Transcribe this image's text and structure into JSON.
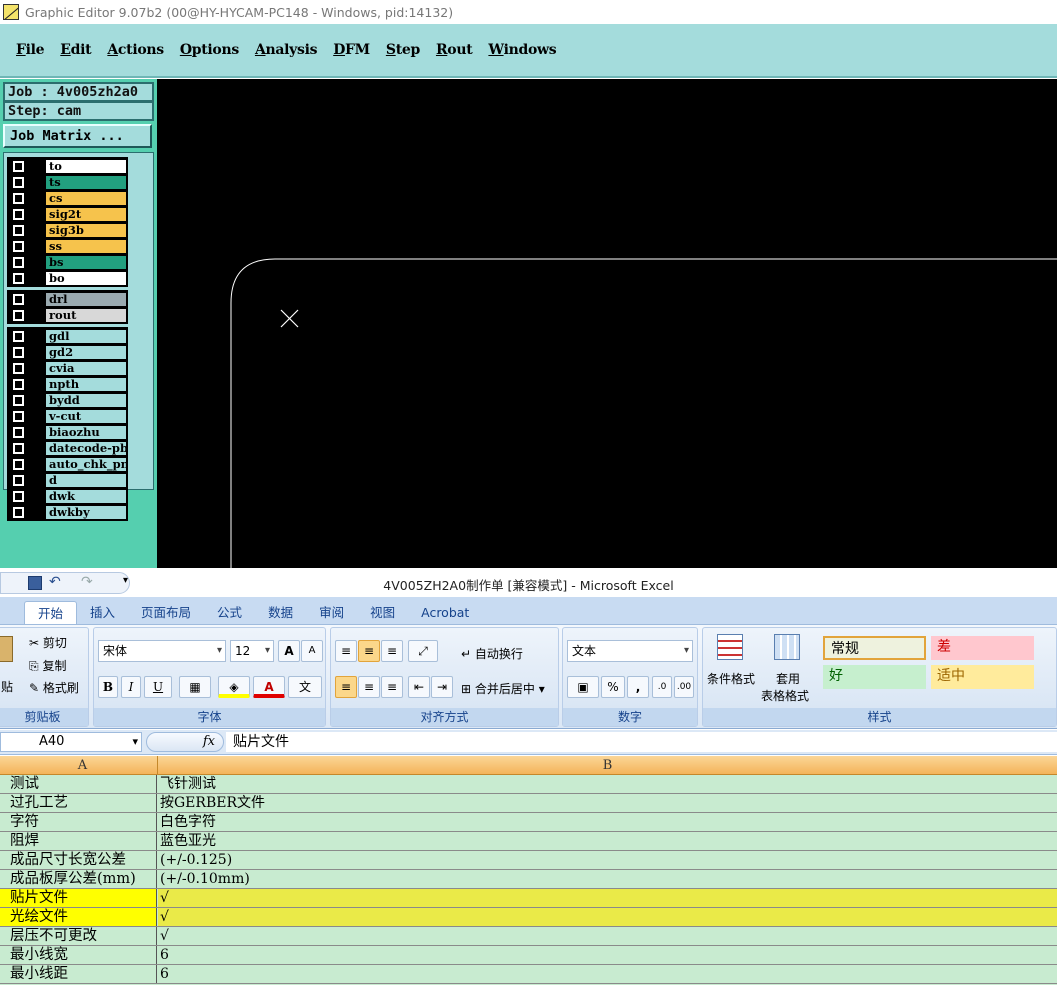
{
  "editor": {
    "title": "Graphic Editor 9.07b2 (00@HY-HYCAM-PC148 - Windows, pid:14132)",
    "menu": [
      "File",
      "Edit",
      "Actions",
      "Options",
      "Analysis",
      "DFM",
      "Step",
      "Rout",
      "Windows"
    ],
    "job_label": "Job : 4v005zh2a0",
    "step_label": "Step: cam",
    "job_matrix": "Job Matrix ...",
    "layer_groups": [
      [
        {
          "name": "to",
          "color": "#ffffff"
        },
        {
          "name": "ts",
          "color": "#22a07f"
        },
        {
          "name": "cs",
          "color": "#f6c34c"
        },
        {
          "name": "sig2t",
          "color": "#f6c34c"
        },
        {
          "name": "sig3b",
          "color": "#f6c34c"
        },
        {
          "name": "ss",
          "color": "#f6c34c"
        },
        {
          "name": "bs",
          "color": "#22a07f"
        },
        {
          "name": "bo",
          "color": "#ffffff"
        }
      ],
      [
        {
          "name": "drl",
          "color": "#9aaab0"
        },
        {
          "name": "rout",
          "color": "#d8d8d8"
        }
      ],
      [
        {
          "name": "gdl",
          "color": "#a4dcdc"
        },
        {
          "name": "gd2",
          "color": "#a4dcdc"
        },
        {
          "name": "cvia",
          "color": "#a4dcdc"
        },
        {
          "name": "npth",
          "color": "#a4dcdc"
        },
        {
          "name": "bydd",
          "color": "#a4dcdc"
        },
        {
          "name": "v-cut",
          "color": "#a4dcdc"
        },
        {
          "name": "biaozhu",
          "color": "#a4dcdc"
        },
        {
          "name": "datecode-pbo",
          "color": "#a4dcdc"
        },
        {
          "name": "auto_chk_pn.",
          "color": "#a4dcdc"
        },
        {
          "name": "d",
          "color": "#a4dcdc"
        },
        {
          "name": "dwk",
          "color": "#a4dcdc"
        },
        {
          "name": "dwkby",
          "color": "#a4dcdc"
        }
      ]
    ]
  },
  "excel": {
    "title": "4V005ZH2A0制作单  [兼容模式] - Microsoft Excel",
    "tabs": [
      "开始",
      "插入",
      "页面布局",
      "公式",
      "数据",
      "审阅",
      "视图",
      "Acrobat"
    ],
    "clipboard": {
      "paste_partial": "贴",
      "cut": "剪切",
      "copy": "复制",
      "format_painter": "格式刷",
      "label": "剪贴板"
    },
    "font": {
      "name": "宋体",
      "size": "12",
      "label": "字体"
    },
    "alignment": {
      "wrap": "自动换行",
      "merge": "合并后居中",
      "label": "对齐方式"
    },
    "number": {
      "format": "文本",
      "percent": "%",
      "comma": ",",
      "label": "数字"
    },
    "styles": {
      "conditional": "条件格式",
      "table_top": "套用",
      "table_bottom": "表格格式",
      "normal": "常规",
      "bad": "差",
      "good": "好",
      "neutral": "适中",
      "label": "样式"
    },
    "name_box": "A40",
    "fx": "fx",
    "formula": "贴片文件",
    "columns": [
      "A",
      "B"
    ],
    "rows": [
      {
        "a": "测试",
        "b": "飞针测试",
        "hl": false
      },
      {
        "a": "过孔工艺",
        "b": "按GERBER文件",
        "hl": false
      },
      {
        "a": "字符",
        "b": "白色字符",
        "hl": false
      },
      {
        "a": "阻焊",
        "b": "蓝色亚光",
        "hl": false
      },
      {
        "a": "成品尺寸长宽公差",
        "b": "(+/-0.125)",
        "hl": false
      },
      {
        "a": "成品板厚公差(mm)",
        "b": "(+/-0.10mm)",
        "hl": false
      },
      {
        "a": "贴片文件",
        "b": "√",
        "hl": true
      },
      {
        "a": "光绘文件",
        "b": "√",
        "hl": true
      },
      {
        "a": "层压不可更改",
        "b": "√",
        "hl": false
      },
      {
        "a": "最小线宽",
        "b": "6",
        "hl": false
      },
      {
        "a": "最小线距",
        "b": "6",
        "hl": false
      }
    ]
  }
}
